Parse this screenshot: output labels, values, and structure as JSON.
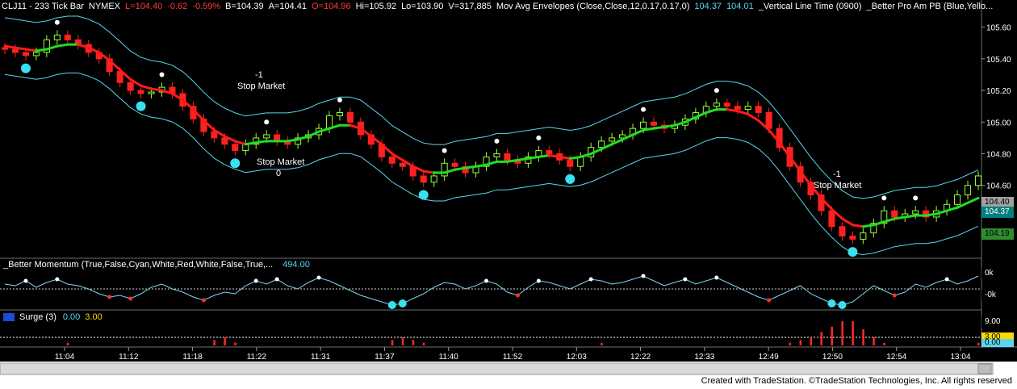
{
  "header": {
    "symbol": "CLJ11 - 233 Tick Bar",
    "exchange": "NYMEX",
    "last": "L=104.40",
    "change": "-0.62",
    "change_pct": "-0.59%",
    "bid": "B=104.39",
    "ask": "A=104.41",
    "open": "O=104.96",
    "high": "Hi=105.92",
    "low": "Lo=103.90",
    "volume": "V=317,885",
    "study1": "Mov Avg Envelopes (Close,Close,12,0.17,0.17,0)",
    "study1_upper": "104.37",
    "study1_lower": "104.01",
    "study2": "_Vertical Line Time (0900)",
    "study3": "_Better Pro Am PB (Blue,Yello..."
  },
  "momentum_panel": {
    "label": "_Better Momentum (True,False,Cyan,White,Red,White,False,True,...",
    "value": "494.00"
  },
  "surge_panel": {
    "label": "Surge (3)",
    "value1": "0.00",
    "value2": "3.00"
  },
  "price_badges": {
    "upper": "104.37",
    "lower": "104.19",
    "last": "104.40"
  },
  "momentum_badges": {
    "top": "0k",
    "bottom": "-0k"
  },
  "surge_badges": {
    "top": "9.00",
    "mid": "3.00",
    "bottom": "0.00"
  },
  "annotations": [
    {
      "id": "a1",
      "top": "-1",
      "bottom": "Stop Market"
    },
    {
      "id": "a2",
      "top": "Stop Market",
      "bottom": "0"
    },
    {
      "id": "a3",
      "top": "-1",
      "bottom": "Stop Market"
    }
  ],
  "footer": "Created with TradeStation. ©TradeStation Technologies, Inc. All rights reserved",
  "chart_data": {
    "type": "candlestick",
    "x_ticks": [
      "11:04",
      "11:12",
      "11:18",
      "11:22",
      "11:31",
      "11:37",
      "11:40",
      "11:52",
      "12:03",
      "12:22",
      "12:33",
      "12:49",
      "12:50",
      "12:54",
      "13:04"
    ],
    "y_ticks": [
      "105.60",
      "105.40",
      "105.20",
      "105.00",
      "104.80",
      "104.60"
    ],
    "ylim": [
      104.15,
      105.7
    ],
    "colors": {
      "background": "#000000",
      "up_candle": "#9aff33",
      "down_candle": "#ff2020",
      "ma_down": "#ff1a1a",
      "ma_up": "#22dd22",
      "envelope": "#5ad6f0",
      "momentum": "#7fd7ee",
      "surge": "#ff2a2a"
    },
    "series": [
      {
        "name": "Close",
        "values": [
          105.46,
          105.44,
          105.42,
          105.44,
          105.52,
          105.55,
          105.52,
          105.49,
          105.44,
          105.4,
          105.32,
          105.25,
          105.2,
          105.18,
          105.19,
          105.22,
          105.18,
          105.1,
          105.02,
          104.94,
          104.9,
          104.86,
          104.82,
          104.86,
          104.9,
          104.92,
          104.88,
          104.86,
          104.9,
          104.92,
          104.96,
          105.04,
          105.06,
          105.0,
          104.92,
          104.86,
          104.78,
          104.74,
          104.72,
          104.66,
          104.62,
          104.66,
          104.74,
          104.72,
          104.68,
          104.72,
          104.78,
          104.8,
          104.76,
          104.74,
          104.78,
          104.82,
          104.8,
          104.76,
          104.72,
          104.78,
          104.84,
          104.88,
          104.9,
          104.92,
          104.96,
          105.0,
          104.98,
          104.96,
          104.98,
          105.02,
          105.06,
          105.1,
          105.12,
          105.1,
          105.08,
          105.1,
          105.06,
          104.96,
          104.84,
          104.72,
          104.62,
          104.54,
          104.44,
          104.34,
          104.28,
          104.26,
          104.3,
          104.36,
          104.44,
          104.4,
          104.42,
          104.44,
          104.4,
          104.44,
          104.48,
          104.54,
          104.6,
          104.66
        ]
      },
      {
        "name": "MA",
        "values": [
          105.48,
          105.47,
          105.46,
          105.45,
          105.46,
          105.48,
          105.49,
          105.49,
          105.47,
          105.44,
          105.39,
          105.33,
          105.27,
          105.23,
          105.21,
          105.2,
          105.18,
          105.14,
          105.08,
          105.01,
          104.95,
          104.91,
          104.88,
          104.86,
          104.87,
          104.88,
          104.88,
          104.88,
          104.89,
          104.91,
          104.94,
          104.96,
          104.98,
          104.98,
          104.96,
          104.91,
          104.86,
          104.8,
          104.76,
          104.72,
          104.69,
          104.68,
          104.68,
          104.7,
          104.71,
          104.72,
          104.73,
          104.75,
          104.75,
          104.76,
          104.77,
          104.78,
          104.79,
          104.78,
          104.77,
          104.78,
          104.8,
          104.83,
          104.86,
          104.89,
          104.92,
          104.95,
          104.96,
          104.97,
          104.98,
          105.0,
          105.03,
          105.06,
          105.08,
          105.08,
          105.07,
          105.05,
          105.01,
          104.95,
          104.87,
          104.78,
          104.69,
          104.6,
          104.52,
          104.45,
          104.39,
          104.35,
          104.34,
          104.35,
          104.37,
          104.39,
          104.4,
          104.41,
          104.41,
          104.42,
          104.44,
          104.46,
          104.49,
          104.52
        ]
      }
    ],
    "momentum": [
      0.3,
      0.2,
      0.5,
      0.1,
      0.4,
      0.6,
      0.3,
      0.2,
      0.0,
      -0.3,
      -0.5,
      -0.4,
      -0.6,
      -0.3,
      0.1,
      0.3,
      0.0,
      -0.2,
      -0.5,
      -0.7,
      -0.4,
      -0.2,
      -0.3,
      0.2,
      0.5,
      0.3,
      0.6,
      0.2,
      0.0,
      0.4,
      0.7,
      0.5,
      0.2,
      -0.1,
      -0.4,
      -0.6,
      -0.8,
      -1.0,
      -0.9,
      -0.6,
      -0.3,
      0.1,
      0.4,
      0.3,
      0.0,
      0.2,
      0.5,
      0.3,
      -0.2,
      -0.4,
      0.1,
      0.5,
      0.4,
      0.2,
      0.0,
      0.3,
      0.6,
      0.5,
      0.3,
      0.4,
      0.6,
      0.8,
      0.5,
      0.2,
      0.4,
      0.6,
      0.3,
      0.5,
      0.7,
      0.4,
      0.1,
      -0.2,
      -0.5,
      -0.7,
      -0.4,
      -0.1,
      0.2,
      -0.3,
      -0.6,
      -0.9,
      -1.0,
      -0.8,
      -0.3,
      0.2,
      -0.1,
      -0.4,
      -0.2,
      0.3,
      0.1,
      0.4,
      0.6,
      0.3,
      0.5,
      0.8
    ],
    "surge": [
      0,
      0,
      0,
      0,
      0,
      0,
      1,
      0,
      0,
      0,
      0,
      0,
      0,
      0,
      0,
      0,
      0,
      0,
      0,
      0,
      2,
      3,
      1,
      0,
      0,
      0,
      0,
      0,
      0,
      0,
      0,
      0,
      0,
      0,
      0,
      0,
      0,
      2,
      3,
      2,
      1,
      0,
      0,
      0,
      0,
      0,
      0,
      0,
      0,
      0,
      0,
      0,
      0,
      0,
      0,
      0,
      0,
      1,
      0,
      0,
      0,
      0,
      0,
      0,
      0,
      0,
      0,
      0,
      0,
      0,
      0,
      0,
      0,
      0,
      0,
      1,
      2,
      3,
      5,
      7,
      9,
      9,
      6,
      3,
      1,
      0,
      0,
      0,
      0,
      0,
      0,
      0,
      0,
      1
    ]
  }
}
